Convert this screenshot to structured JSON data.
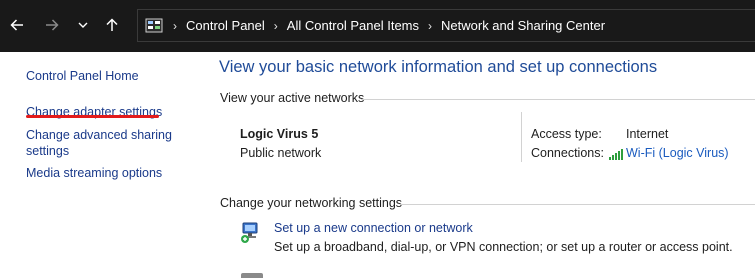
{
  "address_bar": {
    "breadcrumbs": [
      "Control Panel",
      "All Control Panel Items",
      "Network and Sharing Center"
    ]
  },
  "icons": {
    "back": "arrow-left-icon",
    "forward": "arrow-right-icon",
    "recent": "chevron-down-icon",
    "up": "arrow-up-icon",
    "location": "control-panel-icon",
    "connection": "wifi-signal-icon",
    "setup": "network-setup-icon"
  },
  "sidebar": {
    "items": [
      {
        "label": "Control Panel Home"
      },
      {
        "label": "Change adapter settings"
      },
      {
        "label": "Change advanced sharing settings"
      },
      {
        "label": "Media streaming options"
      }
    ]
  },
  "main": {
    "title": "View your basic network information and set up connections",
    "active_networks_label": "View your active networks",
    "network": {
      "name": "Logic Virus 5",
      "category": "Public network",
      "access_type_label": "Access type:",
      "access_type_value": "Internet",
      "connections_label": "Connections:",
      "connections_value": "Wi-Fi (Logic Virus)"
    },
    "change_settings_label": "Change your networking settings",
    "setup_link": "Set up a new connection or network",
    "setup_desc": "Set up a broadband, dial-up, or VPN connection; or set up a router or access point."
  },
  "colors": {
    "topbar_bg": "#191919",
    "link": "#1a3a8a",
    "title": "#1f4b98",
    "annotation_underline": "#e31b1b"
  }
}
